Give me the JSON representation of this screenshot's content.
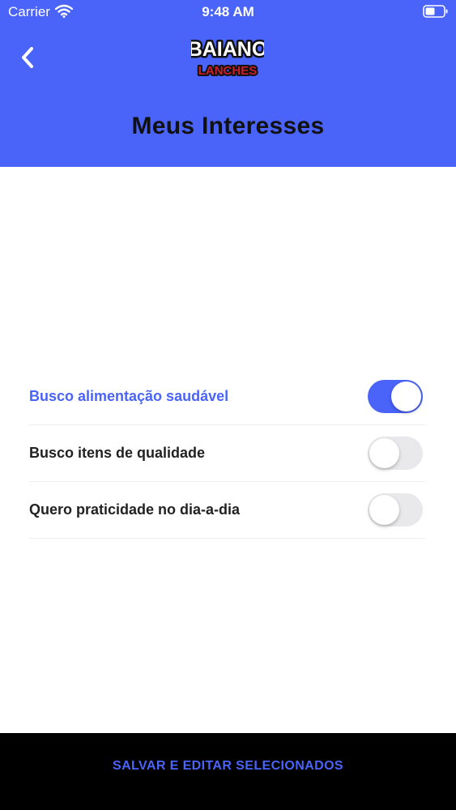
{
  "status_bar": {
    "carrier": "Carrier",
    "time": "9:48 AM"
  },
  "header": {
    "logo_line1": "BAIANO",
    "logo_line2": "LANCHES",
    "title": "Meus Interesses"
  },
  "interests": [
    {
      "label": "Busco alimentação saudável",
      "enabled": true
    },
    {
      "label": "Busco itens de qualidade",
      "enabled": false
    },
    {
      "label": "Quero praticidade no dia-a-dia",
      "enabled": false
    }
  ],
  "footer": {
    "save_label": "SALVAR E EDITAR SELECIONADOS"
  },
  "colors": {
    "accent": "#4a63f8",
    "toggle_off": "#e9e9ec",
    "footer_bg": "#000000",
    "logo_red": "#c8202a"
  },
  "icons": {
    "back": "chevron-left-icon",
    "wifi": "wifi-icon",
    "battery": "battery-icon"
  }
}
